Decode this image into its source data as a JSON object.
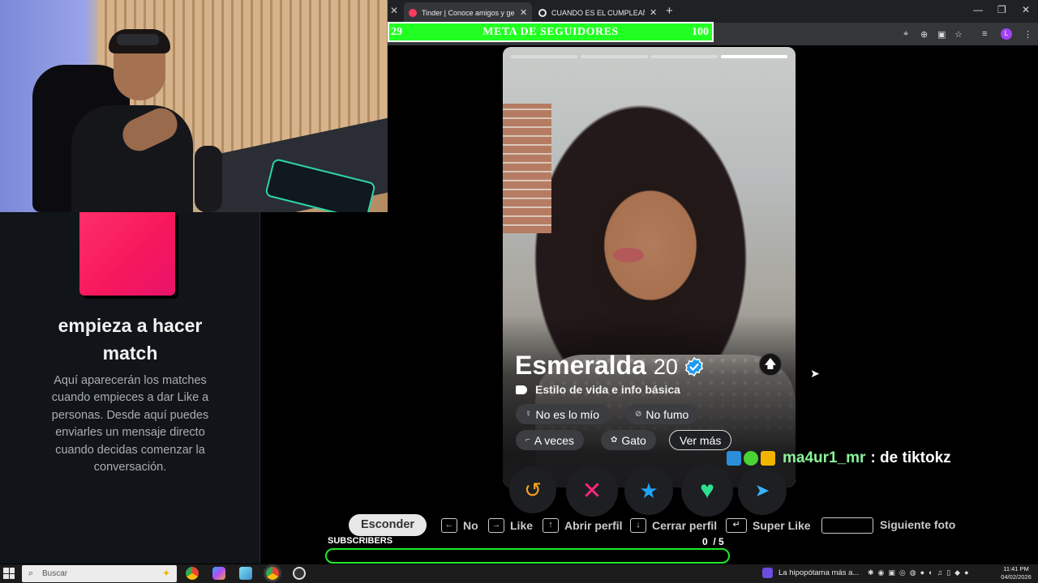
{
  "browser": {
    "tabs": [
      {
        "label": "Tinder | Conoce amigos y gente",
        "active": true
      },
      {
        "label": "CUANDO ES EL CUMPLEAÑOS",
        "active": false
      }
    ],
    "new_tab": "+",
    "window_controls": {
      "minimize": "—",
      "restore": "❐",
      "close": "✕"
    }
  },
  "goal_bar": {
    "current": "29",
    "title": "META DE SEGUIDORES",
    "target": "100"
  },
  "sidebar": {
    "empty_title": "empieza a hacer match",
    "empty_text": "Aquí aparecerán los matches cuando empieces a dar Like a personas. Desde aquí puedes enviarles un mensaje directo cuando decidas comenzar la conversación."
  },
  "profile": {
    "name": "Esmeralda",
    "age": "20",
    "verified": true,
    "photo_count": 4,
    "photo_index": 4,
    "section_label": "Estilo de vida e info básica",
    "chips": [
      {
        "icon": "zodiac-icon",
        "label": "No es lo mío"
      },
      {
        "icon": "no-smoking-icon",
        "label": "No fumo"
      },
      {
        "icon": "drink-icon",
        "label": "A veces"
      },
      {
        "icon": "pet-icon",
        "label": "Gato"
      },
      {
        "icon": "",
        "label": "Ver más"
      }
    ]
  },
  "actions": {
    "rewind": "↺",
    "nope": "✕",
    "super_like": "★",
    "like": "♥",
    "boost": "➤",
    "colors": {
      "rewind": "#f7a11b",
      "nope": "#fd267d",
      "super_like": "#1fa5f8",
      "like": "#2ee08e",
      "boost": "#36b4ff"
    }
  },
  "hints": {
    "hide": "Esconder",
    "no": "No",
    "like": "Like",
    "open_profile": "Abrir perfil",
    "close_profile": "Cerrar perfil",
    "super_like": "Super Like",
    "next_photo": "Siguiente foto"
  },
  "chat": {
    "user": "ma4ur1_mr",
    "message": ": de tiktokz"
  },
  "subscribers": {
    "label": "SUBSCRIBERS",
    "count": "0",
    "goal": "/ 5",
    "progress": 0
  },
  "taskbar": {
    "search_placeholder": "Buscar",
    "news": "La hipopótama más a...",
    "time": "11:41 PM",
    "date": "04/02/2026"
  }
}
